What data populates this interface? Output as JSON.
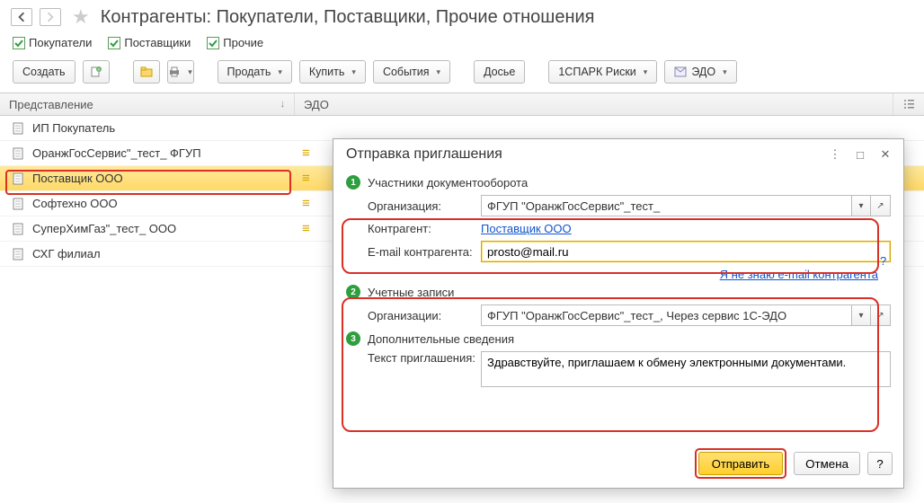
{
  "header": {
    "title": "Контрагенты: Покупатели, Поставщики, Прочие отношения"
  },
  "filters": {
    "buyers": "Покупатели",
    "suppliers": "Поставщики",
    "other": "Прочие"
  },
  "toolbar": {
    "create": "Создать",
    "sell": "Продать",
    "buy": "Купить",
    "events": "События",
    "dossier": "Досье",
    "spark": "1СПАРК Риски",
    "edo": "ЭДО"
  },
  "table": {
    "col_repr": "Представление",
    "col_edo": "ЭДО",
    "rows": [
      {
        "name": "ИП Покупатель",
        "edo": ""
      },
      {
        "name": "ОранжГосСервис\"_тест_ ФГУП",
        "edo": "≡"
      },
      {
        "name": "Поставщик ООО",
        "edo": "≡",
        "selected": true
      },
      {
        "name": "Софтехно ООО",
        "edo": "≡"
      },
      {
        "name": "СуперХимГаз\"_тест_ ООО",
        "edo": "≡"
      },
      {
        "name": "СХГ филиал",
        "edo": ""
      }
    ]
  },
  "dialog": {
    "title": "Отправка приглашения",
    "step1": "Участники документооборота",
    "org_label": "Организация:",
    "org_value": "ФГУП \"ОранжГосСервис\"_тест_",
    "contr_label": "Контрагент:",
    "contr_value": "Поставщик ООО",
    "email_label": "E-mail контрагента:",
    "email_value": "prosto@mail.ru",
    "unknown_email": "Я не знаю e-mail контрагента",
    "step2": "Учетные записи",
    "acc_org_label": "Организации:",
    "acc_org_value": "ФГУП \"ОранжГосСервис\"_тест_, Через сервис 1С-ЭДО",
    "step3": "Дополнительные сведения",
    "invite_text_label": "Текст приглашения:",
    "invite_text_value": "Здравствуйте, приглашаем к обмену электронными документами.",
    "send": "Отправить",
    "cancel": "Отмена",
    "help": "?"
  }
}
